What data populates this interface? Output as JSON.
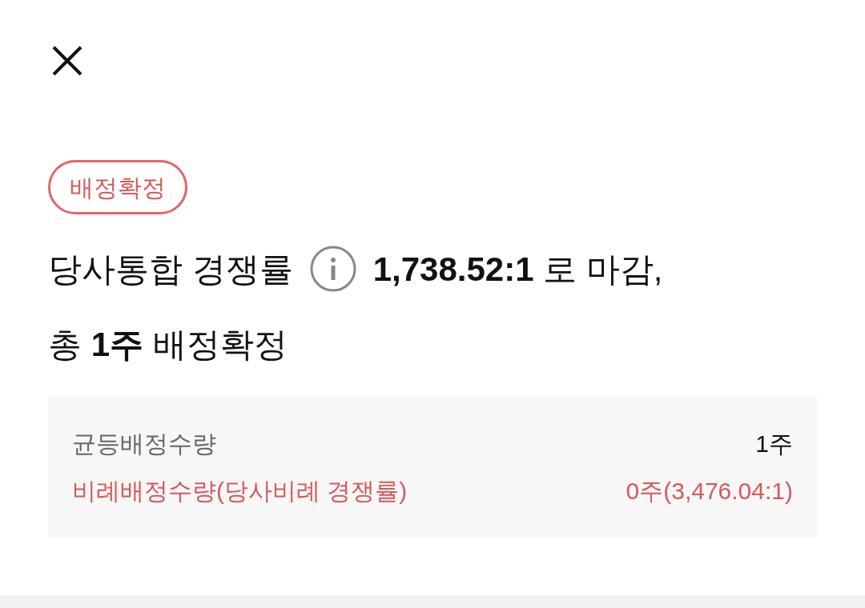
{
  "badge": "배정확정",
  "headline": {
    "line1_start": "당사통합 경쟁률",
    "line1_end": "**1,738.52:1** 로 마감,",
    "line2": "총 **1주** 배정확정"
  },
  "details": [
    {
      "label": "균등배정수량",
      "value": "1주",
      "highlight": false
    },
    {
      "label": "비례배정수량(당사비례 경쟁률)",
      "value": "0주(3,476.04:1)",
      "highlight": true
    }
  ]
}
